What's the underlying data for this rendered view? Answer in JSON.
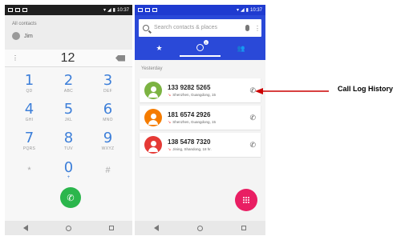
{
  "left_phone": {
    "status_time": "10:37",
    "all_contacts_label": "All contacts",
    "contact_name": "Jim",
    "menu_glyph": "⋮",
    "dial_number": "12",
    "keys": [
      {
        "digit": "1",
        "letters": "QD"
      },
      {
        "digit": "2",
        "letters": "ABC"
      },
      {
        "digit": "3",
        "letters": "DEF"
      },
      {
        "digit": "4",
        "letters": "GHI"
      },
      {
        "digit": "5",
        "letters": "JKL"
      },
      {
        "digit": "6",
        "letters": "MNO"
      },
      {
        "digit": "7",
        "letters": "PQRS"
      },
      {
        "digit": "8",
        "letters": "TUV"
      },
      {
        "digit": "9",
        "letters": "WXYZ"
      },
      {
        "symbol": "*"
      },
      {
        "digit": "0",
        "letters": "+"
      },
      {
        "symbol": "#"
      }
    ]
  },
  "right_phone": {
    "status_time": "10:37",
    "search_placeholder": "Search contacts & places",
    "more_glyph": "⋮",
    "tabs": [
      {
        "name": "favorites",
        "icon": "star-icon",
        "glyph": "★"
      },
      {
        "name": "recents",
        "icon": "clock-icon",
        "badge": "3"
      },
      {
        "name": "contacts",
        "icon": "people-icon",
        "glyph": "👥"
      }
    ],
    "section_label": "Yesterday",
    "calls": [
      {
        "number": "133 9282 5265",
        "location": "Shenzhen, Guangdong, 15",
        "avatar_color": "#7cb342"
      },
      {
        "number": "181 6574 2926",
        "location": "Shenzhen, Guangdong, 15",
        "avatar_color": "#f57c00"
      },
      {
        "number": "138 5478 7320",
        "location": "Jining, Shandong, 18 hr.",
        "avatar_color": "#e53935"
      }
    ]
  },
  "annotation": {
    "label": "Call Log History",
    "arrow_color": "#cc0000"
  },
  "colors": {
    "blue_header": "#2a49d8",
    "call_button": "#2bb64c",
    "fab": "#e91e63",
    "key_digit": "#3d7fd9"
  }
}
